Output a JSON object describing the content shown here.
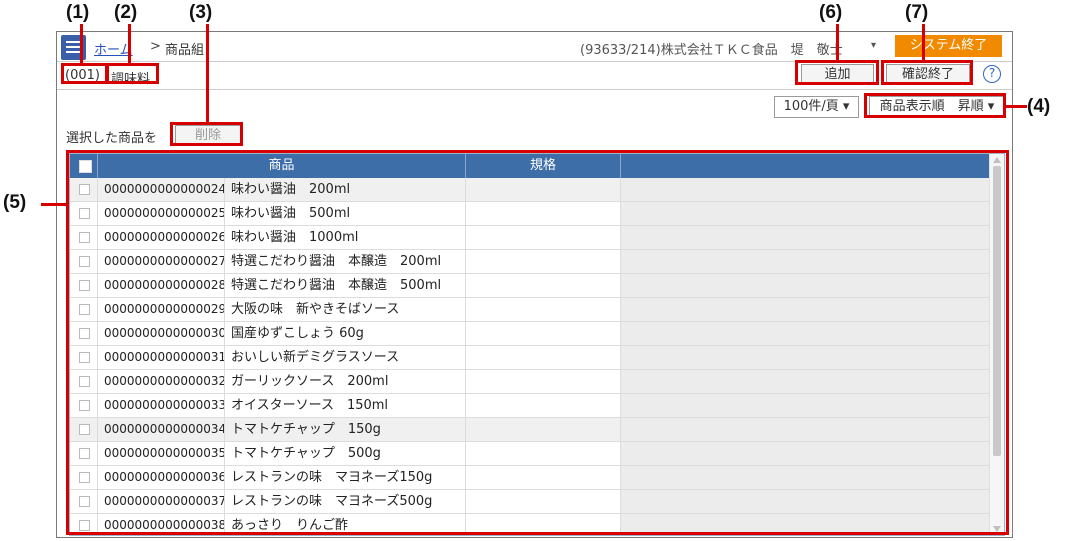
{
  "callouts": [
    "(1)",
    "(2)",
    "(3)",
    "(4)",
    "(5)",
    "(6)",
    "(7)"
  ],
  "header": {
    "home_label": "ホーム",
    "breadcrumb_sep": ">",
    "breadcrumb_current": "商品組",
    "user_info": "(93633/214)株式会社ＴＫＣ食品　堤　敬士",
    "user_caret": "▾",
    "system_exit_label": "システム終了"
  },
  "category": {
    "code": "(001)",
    "name": "調味料"
  },
  "toolbar": {
    "add_label": "追加",
    "confirm_label": "確認終了",
    "help_symbol": "?"
  },
  "paging": {
    "per_page": "100件/頁 ▾",
    "sort": "商品表示順　昇順 ▾"
  },
  "selection": {
    "label": "選択した商品を",
    "delete_label": "削除"
  },
  "grid": {
    "columns": [
      "商品",
      "規格"
    ],
    "rows": [
      {
        "code": "0000000000000024",
        "name": "味わい醤油　200ml"
      },
      {
        "code": "0000000000000025",
        "name": "味わい醤油　500ml"
      },
      {
        "code": "0000000000000026",
        "name": "味わい醤油　1000ml"
      },
      {
        "code": "0000000000000027",
        "name": "特選こだわり醤油　本醸造　200ml"
      },
      {
        "code": "0000000000000028",
        "name": "特選こだわり醤油　本醸造　500ml"
      },
      {
        "code": "0000000000000029",
        "name": "大阪の味　新やきそばソース"
      },
      {
        "code": "0000000000000030",
        "name": "国産ゆずこしょう 60g"
      },
      {
        "code": "0000000000000031",
        "name": "おいしい新デミグラスソース"
      },
      {
        "code": "0000000000000032",
        "name": "ガーリックソース　200ml"
      },
      {
        "code": "0000000000000033",
        "name": "オイスターソース　150ml"
      },
      {
        "code": "0000000000000034",
        "name": "トマトケチャップ　150g"
      },
      {
        "code": "0000000000000035",
        "name": "トマトケチャップ　500g"
      },
      {
        "code": "0000000000000036",
        "name": "レストランの味　マヨネーズ150g"
      },
      {
        "code": "0000000000000037",
        "name": "レストランの味　マヨネーズ500g"
      },
      {
        "code": "0000000000000038",
        "name": "あっさり　りんご酢"
      }
    ]
  },
  "colors": {
    "accent": "#3d6ea8",
    "exit": "#f28a00",
    "callout_box": "#d60000"
  }
}
